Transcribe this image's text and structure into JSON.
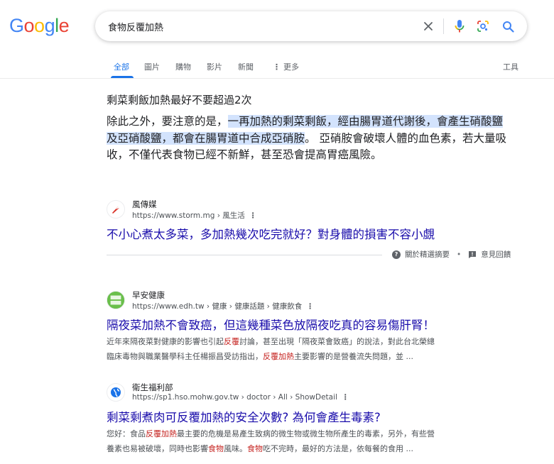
{
  "search": {
    "query": "食物反覆加熱",
    "clear_icon": "close-icon",
    "voice_icon": "mic-icon",
    "lens_icon": "lens-icon",
    "search_icon": "search-icon"
  },
  "logo": {
    "text": "Google"
  },
  "tabs": [
    {
      "label": "全部",
      "active": true
    },
    {
      "label": "圖片"
    },
    {
      "label": "購物"
    },
    {
      "label": "影片"
    },
    {
      "label": "新聞"
    },
    {
      "label": "更多"
    }
  ],
  "tools_label": "工具",
  "featured": {
    "title": "剩菜剩飯加熱最好不要超過2次",
    "body_pre": "除此之外，要注意的是，",
    "body_highlight": "一再加熱的剩菜剩飯，經由腸胃道代謝後，會產生硝酸鹽及亞硝酸鹽，都會在腸胃道中合成亞硝胺",
    "body_post": "。 亞硝胺會破壞人體的血色素，若大量吸收，不僅代表食物已經不新鮮，甚至恐會提高胃癌風險。",
    "source_name": "風傳媒",
    "source_url": "https://www.storm.mg › 風生活",
    "link_title": "不小心煮太多菜，多加熱幾次吃完就好？對身體的損害不容小覷",
    "about_label": "關於精選摘要",
    "feedback_label": "意見回饋"
  },
  "results": [
    {
      "site": "早安健康",
      "url": "https://www.edh.tw › 健康 › 健康話題 › 健康飲食",
      "title": "隔夜菜加熱不會致癌，但這幾種菜色放隔夜吃真的容易傷肝腎！",
      "desc_1a": "近年來隔夜菜對健康的影響也引起",
      "desc_1b": "反覆",
      "desc_1c": "討論，甚至出現「隔夜菜會致癌」的說法，對此台北榮總",
      "desc_2a": "臨床毒物與職業醫學科主任楊振昌受訪指出，",
      "desc_2b": "反覆加熱",
      "desc_2c": "主要影響的是營養流失問題，並 ..."
    },
    {
      "site": "衛生福利部",
      "url": "https://sp1.hso.mohw.gov.tw › doctor › All › ShowDetail",
      "title": "剩菜剩煮肉可反覆加熱的安全次數? 為何會產生毒素?",
      "desc_1a": "您好：食品",
      "desc_1b": "反覆加熱",
      "desc_1c": "最主要的危機是易產生致病的微生物或微生物所產生的毒素，另外，有些營",
      "desc_2a": "養素也易被破壞，同時也影響",
      "desc_2b": "食物",
      "desc_2c": "風味。",
      "desc_2d": "食物",
      "desc_2e": "吃不完時，最好的方法是，依每餐的食用 ..."
    }
  ]
}
